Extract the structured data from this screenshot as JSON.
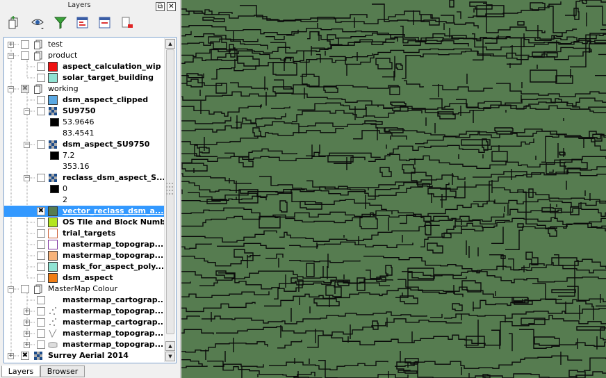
{
  "panel": {
    "title": "Layers",
    "float_label": "⧉",
    "close_label": "✕"
  },
  "layers": [
    {
      "label": "test",
      "kind": "group",
      "expanded": false,
      "checked": "off"
    },
    {
      "label": "product",
      "kind": "group",
      "expanded": true,
      "checked": "off"
    },
    {
      "label": "aspect_calculation_wip",
      "kind": "layer",
      "swatch": "#ee1111",
      "checked": "off",
      "bold": true
    },
    {
      "label": "solar_target_building",
      "kind": "layer",
      "swatch": "#8fe3d3",
      "checked": "off",
      "bold": true
    },
    {
      "label": "working",
      "kind": "group",
      "expanded": true,
      "checked": "partial"
    },
    {
      "label": "dsm_aspect_clipped",
      "kind": "layer",
      "swatch": "#5aa8e3",
      "checked": "off",
      "bold": true
    },
    {
      "label": "SU9750",
      "kind": "raster",
      "expanded": true,
      "checked": "off",
      "bold": true
    },
    {
      "label": "53.9646",
      "kind": "legend",
      "swatch": "#000000"
    },
    {
      "label": "83.4541",
      "kind": "legend",
      "swatch": "#ffffff"
    },
    {
      "label": "dsm_aspect_SU9750",
      "kind": "raster",
      "expanded": true,
      "checked": "off",
      "bold": true
    },
    {
      "label": "7.2",
      "kind": "legend",
      "swatch": "#000000"
    },
    {
      "label": "353.16",
      "kind": "legend",
      "swatch": "#ffffff"
    },
    {
      "label": "reclass_dsm_aspect_S...",
      "kind": "raster",
      "expanded": true,
      "checked": "off",
      "bold": true
    },
    {
      "label": "0",
      "kind": "legend",
      "swatch": "#000000"
    },
    {
      "label": "2",
      "kind": "legend",
      "swatch": "#ffffff"
    },
    {
      "label": "vector_reclass_dsm_a...",
      "kind": "layer",
      "swatch": "#567c50",
      "checked": "on",
      "bold": true,
      "selected": true
    },
    {
      "label": "OS Tile and Block Numb...",
      "kind": "layer",
      "swatch": "#b4e61e",
      "checked": "off",
      "bold": true
    },
    {
      "label": "trial_targets",
      "kind": "layer",
      "swatch": "#ffffff",
      "swatch_border": "#c85a32",
      "checked": "off",
      "bold": true
    },
    {
      "label": "mastermap_topograp...",
      "kind": "layer",
      "swatch": "#ffffff",
      "swatch_border": "#7a2d9b",
      "checked": "off",
      "bold": true
    },
    {
      "label": "mastermap_topograp...",
      "kind": "layer",
      "swatch": "#f7b37a",
      "checked": "off",
      "bold": true
    },
    {
      "label": "mask_for_aspect_poly...",
      "kind": "layer",
      "swatch": "#8fe3d3",
      "checked": "off",
      "bold": true
    },
    {
      "label": "dsm_aspect",
      "kind": "layer",
      "swatch": "#f07d14",
      "checked": "off",
      "bold": true
    },
    {
      "label": "MasterMap Colour",
      "kind": "group",
      "expanded": true,
      "checked": "off"
    },
    {
      "label": "mastermap_cartograp...",
      "kind": "layer",
      "checked": "off",
      "bold": true,
      "icon": "blank-icon"
    },
    {
      "label": "mastermap_topograp...",
      "kind": "layer",
      "expandable": true,
      "checked": "off",
      "bold": true,
      "icon": "point-dots-icon"
    },
    {
      "label": "mastermap_cartograp...",
      "kind": "layer",
      "expandable": true,
      "checked": "off",
      "bold": true,
      "icon": "point-dots-icon"
    },
    {
      "label": "mastermap_topograp...",
      "kind": "layer",
      "expandable": true,
      "checked": "off",
      "bold": true,
      "icon": "line-style-icon"
    },
    {
      "label": "mastermap_topograp...",
      "kind": "layer",
      "expandable": true,
      "checked": "off",
      "bold": true,
      "icon": "polygon-style-icon"
    },
    {
      "label": "Surrey Aerial 2014",
      "kind": "raster-top",
      "expandable": true,
      "checked": "on",
      "bold": true
    }
  ],
  "tabs": [
    "Layers",
    "Browser"
  ],
  "colors": {
    "map_fill": "#567c50",
    "map_line": "#0a0a0a",
    "selection": "#3399ff"
  }
}
